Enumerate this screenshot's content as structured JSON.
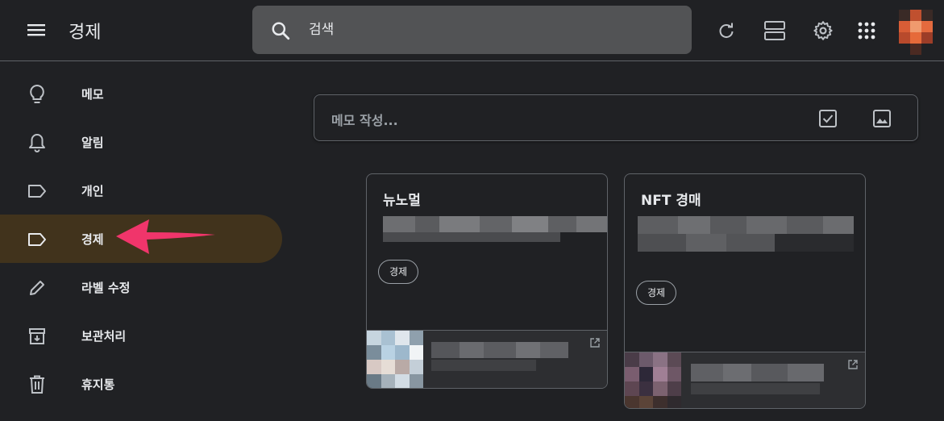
{
  "header": {
    "app_title": "경제",
    "search_placeholder": "검색",
    "icons": [
      "menu-icon",
      "search-icon",
      "refresh-icon",
      "list-view-icon",
      "settings-icon",
      "apps-icon"
    ]
  },
  "sidebar": {
    "items": [
      {
        "label": "메모",
        "icon": "lightbulb-icon",
        "active": false
      },
      {
        "label": "알림",
        "icon": "bell-icon",
        "active": false
      },
      {
        "label": "개인",
        "icon": "label-icon",
        "active": false
      },
      {
        "label": "경제",
        "icon": "label-icon",
        "active": true
      },
      {
        "label": "라벨 수정",
        "icon": "pencil-icon",
        "active": false
      },
      {
        "label": "보관처리",
        "icon": "archive-icon",
        "active": false
      },
      {
        "label": "휴지통",
        "icon": "trash-icon",
        "active": false
      }
    ]
  },
  "composer": {
    "placeholder": "메모 작성...",
    "icons": [
      "checkbox-icon",
      "image-icon"
    ]
  },
  "notes": [
    {
      "title": "뉴노멀",
      "label": "경제"
    },
    {
      "title": "NFT 경매",
      "label": "경제"
    }
  ],
  "colors": {
    "background": "#202124",
    "active_label": "#41331c",
    "arrow": "#f0356b"
  }
}
